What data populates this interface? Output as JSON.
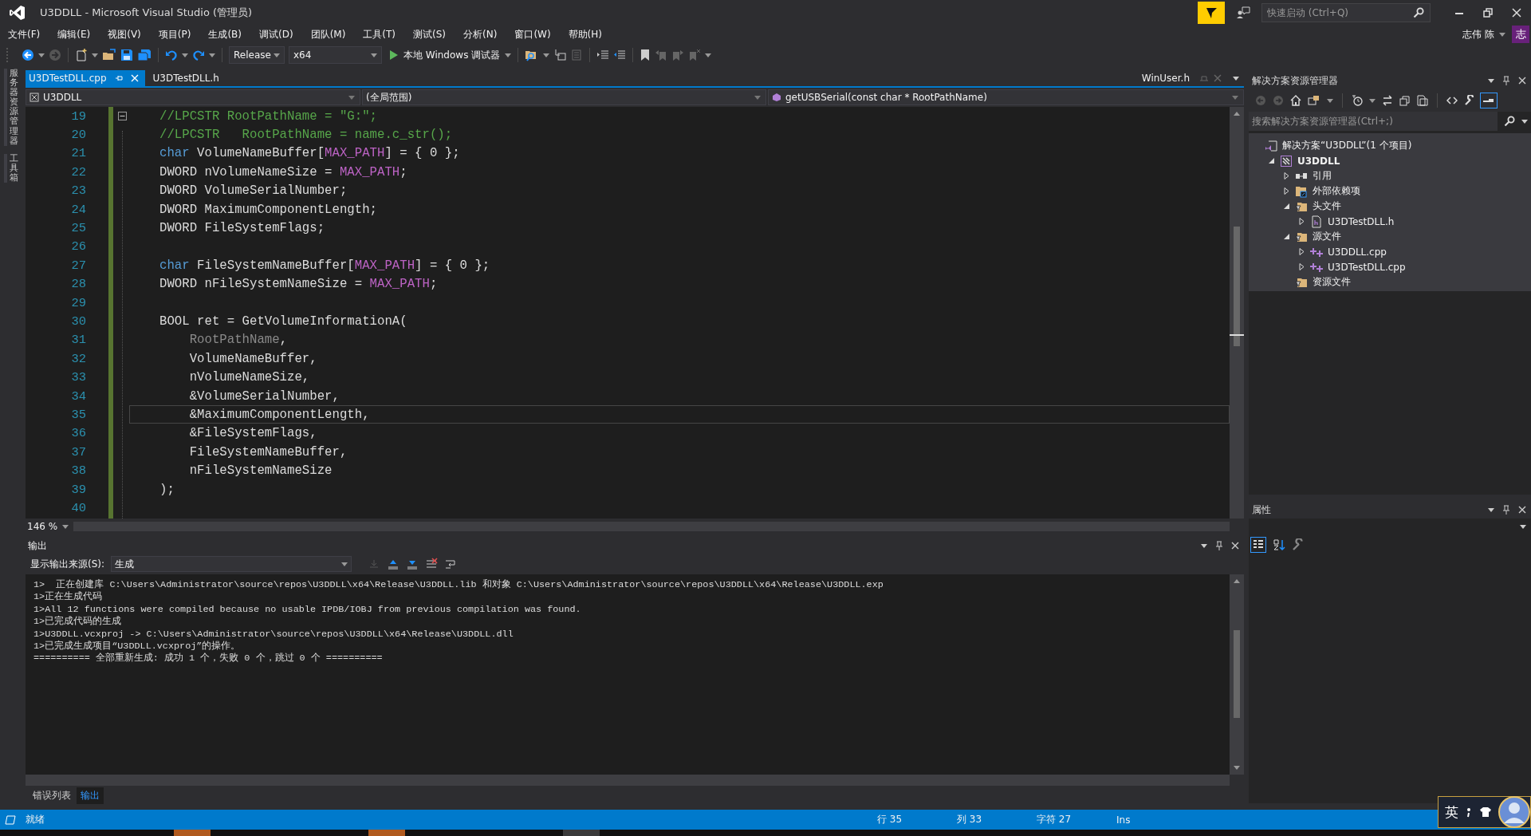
{
  "window": {
    "title": "U3DDLL - Microsoft Visual Studio (管理员)",
    "quick_launch": {
      "placeholder": "快速启动 (Ctrl+Q)"
    },
    "user": "志伟 陈",
    "user_badge": "志"
  },
  "menu": [
    "文件(F)",
    "编辑(E)",
    "视图(V)",
    "项目(P)",
    "生成(B)",
    "调试(D)",
    "团队(M)",
    "工具(T)",
    "测试(S)",
    "分析(N)",
    "窗口(W)",
    "帮助(H)"
  ],
  "toolbar": {
    "configuration": "Release",
    "platform": "x64",
    "debugger": "本地 Windows 调试器"
  },
  "left_strip": [
    "服务器资源管理器",
    "工具箱"
  ],
  "doc_tabs": [
    {
      "label": "U3DTestDLL.cpp",
      "selected": true
    },
    {
      "label": "U3DTestDLL.h",
      "selected": false
    }
  ],
  "preview_tab": "WinUser.h",
  "nav_bar": {
    "project": "U3DDLL",
    "scope": "(全局范围)",
    "member": "getUSBSerial(const char * RootPathName)"
  },
  "editor": {
    "zoom": "146 %",
    "lines": [
      {
        "number": "19",
        "current": false,
        "tokens": [
          {
            "kind": "comment",
            "text": "//LPCSTR RootPathName = \"G:\";"
          }
        ]
      },
      {
        "number": "20",
        "current": false,
        "tokens": [
          {
            "kind": "comment",
            "text": "//LPCSTR   RootPathName = name.c_str();"
          }
        ]
      },
      {
        "number": "21",
        "current": false,
        "tokens": [
          {
            "kind": "keyword",
            "text": "char"
          },
          {
            "kind": "plain",
            "text": " VolumeNameBuffer["
          },
          {
            "kind": "macro",
            "text": "MAX_PATH"
          },
          {
            "kind": "plain",
            "text": "] = { 0 };"
          }
        ]
      },
      {
        "number": "22",
        "current": false,
        "tokens": [
          {
            "kind": "plain",
            "text": "DWORD nVolumeNameSize = "
          },
          {
            "kind": "macro",
            "text": "MAX_PATH"
          },
          {
            "kind": "plain",
            "text": ";"
          }
        ]
      },
      {
        "number": "23",
        "current": false,
        "tokens": [
          {
            "kind": "plain",
            "text": "DWORD VolumeSerialNumber;"
          }
        ]
      },
      {
        "number": "24",
        "current": false,
        "tokens": [
          {
            "kind": "plain",
            "text": "DWORD MaximumComponentLength;"
          }
        ]
      },
      {
        "number": "25",
        "current": false,
        "tokens": [
          {
            "kind": "plain",
            "text": "DWORD FileSystemFlags;"
          }
        ]
      },
      {
        "number": "26",
        "current": false
      },
      {
        "number": "27",
        "current": false,
        "tokens": [
          {
            "kind": "keyword",
            "text": "char"
          },
          {
            "kind": "plain",
            "text": " FileSystemNameBuffer["
          },
          {
            "kind": "macro",
            "text": "MAX_PATH"
          },
          {
            "kind": "plain",
            "text": "] = { 0 };"
          }
        ]
      },
      {
        "number": "28",
        "current": false,
        "tokens": [
          {
            "kind": "plain",
            "text": "DWORD nFileSystemNameSize = "
          },
          {
            "kind": "macro",
            "text": "MAX_PATH"
          },
          {
            "kind": "plain",
            "text": ";"
          }
        ]
      },
      {
        "number": "29",
        "current": false
      },
      {
        "number": "30",
        "current": false,
        "tokens": [
          {
            "kind": "plain",
            "text": "BOOL ret = GetVolumeInformationA("
          }
        ]
      },
      {
        "number": "31",
        "current": false,
        "tokens": [
          {
            "kind": "param",
            "text": "    RootPathName"
          },
          {
            "kind": "plain",
            "text": ","
          }
        ]
      },
      {
        "number": "32",
        "current": false,
        "tokens": [
          {
            "kind": "plain",
            "text": "    VolumeNameBuffer,"
          }
        ]
      },
      {
        "number": "33",
        "current": false,
        "tokens": [
          {
            "kind": "plain",
            "text": "    nVolumeNameSize,"
          }
        ]
      },
      {
        "number": "34",
        "current": false,
        "tokens": [
          {
            "kind": "plain",
            "text": "    &VolumeSerialNumber,"
          }
        ]
      },
      {
        "number": "35",
        "current": true,
        "tokens": [
          {
            "kind": "plain",
            "text": "    &MaximumComponentLength,"
          }
        ]
      },
      {
        "number": "36",
        "current": false,
        "tokens": [
          {
            "kind": "plain",
            "text": "    &FileSystemFlags,"
          }
        ]
      },
      {
        "number": "37",
        "current": false,
        "tokens": [
          {
            "kind": "plain",
            "text": "    FileSystemNameBuffer,"
          }
        ]
      },
      {
        "number": "38",
        "current": false,
        "tokens": [
          {
            "kind": "plain",
            "text": "    nFileSystemNameSize"
          }
        ]
      },
      {
        "number": "39",
        "current": false,
        "tokens": [
          {
            "kind": "plain",
            "text": ");"
          }
        ]
      },
      {
        "number": "40",
        "current": false
      }
    ]
  },
  "output": {
    "title": "输出",
    "source_label": "显示输出来源(S):",
    "source": "生成",
    "lines": [
      "1>  正在创建库 C:\\Users\\Administrator\\source\\repos\\U3DDLL\\x64\\Release\\U3DDLL.lib 和对象 C:\\Users\\Administrator\\source\\repos\\U3DDLL\\x64\\Release\\U3DDLL.exp",
      "1>正在生成代码",
      "1>All 12 functions were compiled because no usable IPDB/IOBJ from previous compilation was found.",
      "1>已完成代码的生成",
      "1>U3DDLL.vcxproj -> C:\\Users\\Administrator\\source\\repos\\U3DDLL\\x64\\Release\\U3DDLL.dll",
      "1>已完成生成项目“U3DDLL.vcxproj”的操作。",
      "========== 全部重新生成: 成功 1 个，失败 0 个，跳过 0 个 =========="
    ]
  },
  "bottom_tabs": [
    {
      "label": "错误列表",
      "selected": false
    },
    {
      "label": "输出",
      "selected": true
    }
  ],
  "solution_explorer": {
    "title": "解决方案资源管理器",
    "search": {
      "placeholder": "搜索解决方案资源管理器(Ctrl+;)"
    },
    "tree": [
      {
        "label": "解决方案“U3DDLL”(1 个项目)",
        "kind": "solution",
        "children": [
          {
            "label": "U3DDLL",
            "kind": "project",
            "expanded": true,
            "children": [
              {
                "label": "引用",
                "kind": "references",
                "expanded": false
              },
              {
                "label": "外部依赖项",
                "kind": "external",
                "expanded": false
              },
              {
                "label": "头文件",
                "kind": "folder",
                "expanded": true,
                "children": [
                  {
                    "label": "U3DTestDLL.h",
                    "kind": "header",
                    "expanded": false
                  }
                ]
              },
              {
                "label": "源文件",
                "kind": "folder",
                "expanded": true,
                "children": [
                  {
                    "label": "U3DDLL.cpp",
                    "kind": "cpp",
                    "expanded": false
                  },
                  {
                    "label": "U3DTestDLL.cpp",
                    "kind": "cpp",
                    "expanded": false
                  }
                ]
              },
              {
                "label": "资源文件",
                "kind": "folder"
              }
            ]
          }
        ]
      }
    ]
  },
  "properties": {
    "title": "属性"
  },
  "status_bar": {
    "message": "就绪",
    "line": "行 35",
    "column": "列 33",
    "char": "字符 27",
    "mode": "Ins"
  },
  "ime": {
    "label": "英"
  }
}
